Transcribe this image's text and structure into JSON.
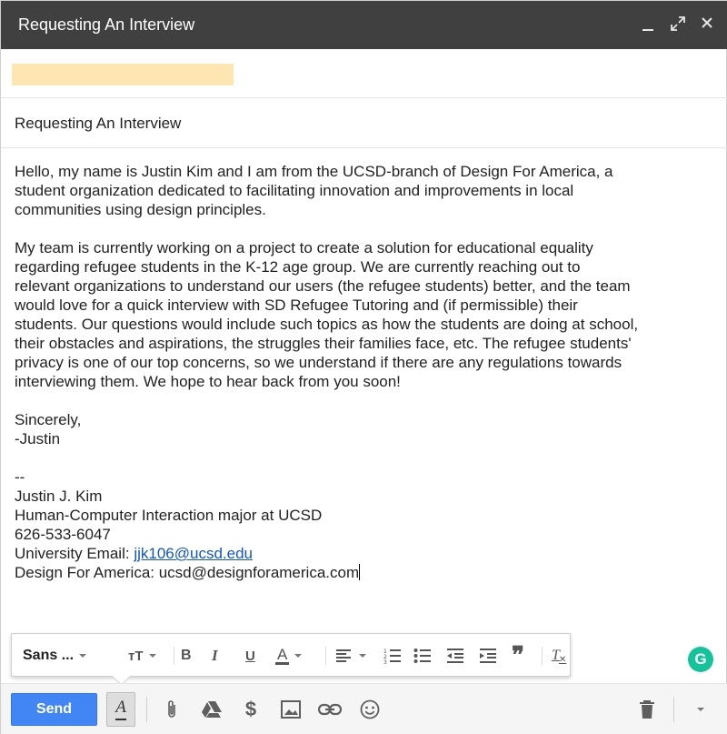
{
  "window": {
    "title": "Requesting An Interview",
    "controls": {
      "minimize": "minimize",
      "expand": "expand",
      "close": "close"
    }
  },
  "recipients": {
    "chip_color": "#fde6b1"
  },
  "subject": {
    "value": "Requesting An Interview"
  },
  "body": {
    "para1": [
      "Hello, my name is Justin Kim and I am from the UCSD-branch of Design For America, a",
      "student organization dedicated to facilitating innovation and improvements in local",
      "communities using design principles."
    ],
    "para2": [
      "My team is currently working on a project to create a solution for educational equality",
      "regarding refugee students in the K-12 age group. We are currently reaching out to",
      "relevant organizations to understand our users (the refugee students) better, and the team",
      "would love for a quick interview with SD Refugee Tutoring and (if permissible) their",
      "students. Our questions would include such topics as how the students are doing at school,",
      "their obstacles and aspirations, the struggles their families face, etc. The refugee students'",
      "privacy is one of our top concerns, so we understand if there are any regulations towards",
      "interviewing them. We hope to hear back from you soon!"
    ],
    "closing": [
      "Sincerely,",
      "-Justin"
    ],
    "signature": {
      "separator": "--",
      "name": "Justin J. Kim",
      "role": "Human-Computer Interaction major at UCSD",
      "phone": "626-533-6047",
      "email_label": "University Email: ",
      "email": "jjk106@ucsd.edu",
      "dfa_line": "Design For America: ucsd@designforamerica.com"
    }
  },
  "formatting": {
    "font": "Sans ...",
    "size_label": "тT",
    "bold": "B",
    "italic": "I",
    "underline": "U",
    "text_color": "A",
    "quote": "❞",
    "clear": "T"
  },
  "grammarly": {
    "label": "G",
    "color": "#15c39a"
  },
  "bottom": {
    "send_label": "Send",
    "format_label": "A",
    "money_label": "$",
    "send_color": "#4285f4",
    "icons": [
      "paperclip-icon",
      "google-drive-icon",
      "dollar-icon",
      "photo-icon",
      "link-icon",
      "emoji-icon",
      "trash-icon",
      "more-options-icon"
    ]
  }
}
